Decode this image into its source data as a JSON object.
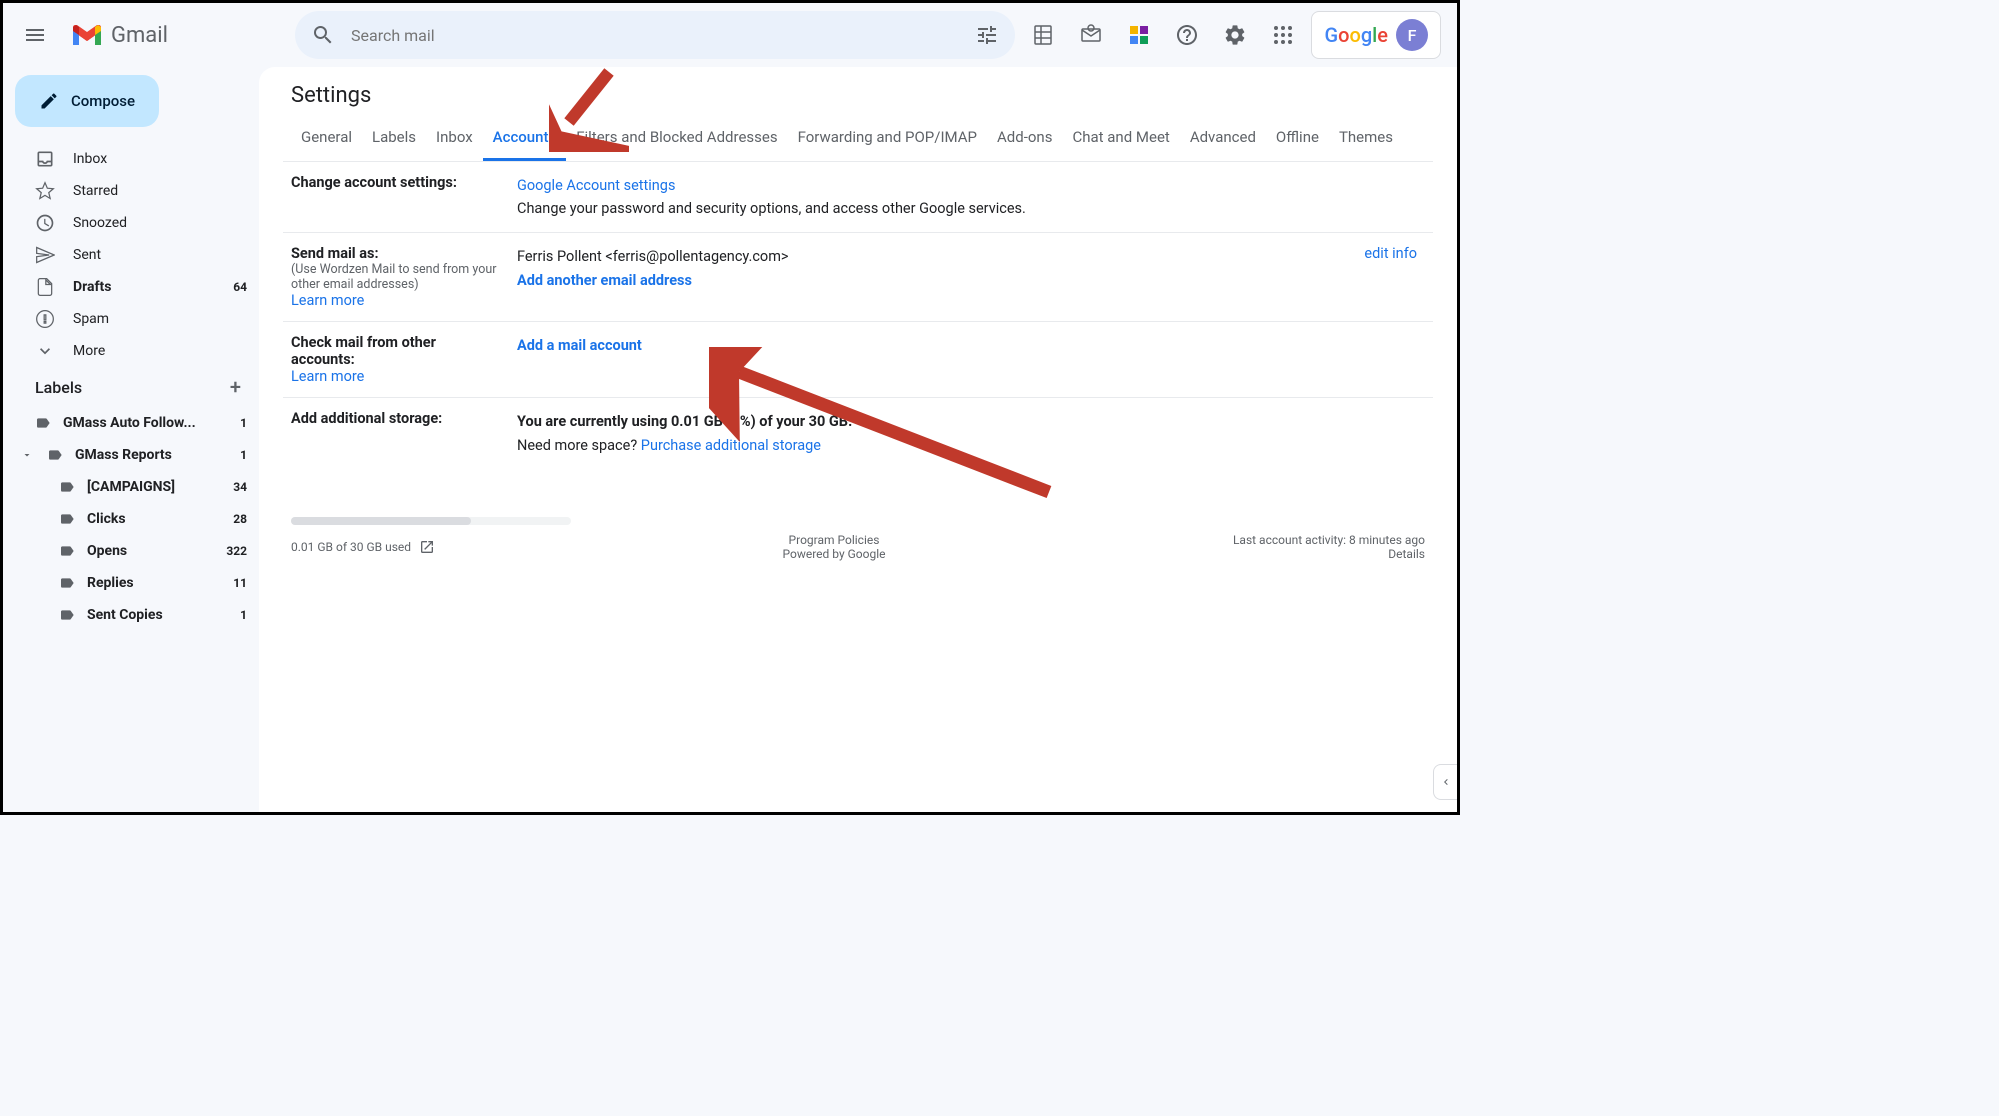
{
  "header": {
    "product": "Gmail",
    "search_placeholder": "Search mail",
    "avatar_initial": "F",
    "google_text": "Google"
  },
  "sidebar": {
    "compose": "Compose",
    "nav": [
      {
        "label": "Inbox",
        "count": "",
        "bold": false
      },
      {
        "label": "Starred",
        "count": "",
        "bold": false
      },
      {
        "label": "Snoozed",
        "count": "",
        "bold": false
      },
      {
        "label": "Sent",
        "count": "",
        "bold": false
      },
      {
        "label": "Drafts",
        "count": "64",
        "bold": true
      },
      {
        "label": "Spam",
        "count": "",
        "bold": false
      },
      {
        "label": "More",
        "count": "",
        "bold": false
      }
    ],
    "labels_header": "Labels",
    "labels": [
      {
        "label": "GMass Auto Follow...",
        "count": "1",
        "bold": true,
        "indent": 0,
        "caret": false
      },
      {
        "label": "GMass Reports",
        "count": "1",
        "bold": true,
        "indent": 0,
        "caret": true
      },
      {
        "label": "[CAMPAIGNS]",
        "count": "34",
        "bold": true,
        "indent": 1,
        "caret": false
      },
      {
        "label": "Clicks",
        "count": "28",
        "bold": true,
        "indent": 1,
        "caret": false
      },
      {
        "label": "Opens",
        "count": "322",
        "bold": true,
        "indent": 1,
        "caret": false
      },
      {
        "label": "Replies",
        "count": "11",
        "bold": true,
        "indent": 1,
        "caret": false
      },
      {
        "label": "Sent Copies",
        "count": "1",
        "bold": true,
        "indent": 1,
        "caret": false
      }
    ]
  },
  "main": {
    "title": "Settings",
    "tabs": [
      "General",
      "Labels",
      "Inbox",
      "Accounts",
      "Filters and Blocked Addresses",
      "Forwarding and POP/IMAP",
      "Add-ons",
      "Chat and Meet",
      "Advanced",
      "Offline",
      "Themes"
    ],
    "active_tab": "Accounts",
    "sections": {
      "change_account": {
        "title": "Change account settings:",
        "link": "Google Account settings",
        "desc": "Change your password and security options, and access other Google services."
      },
      "send_as": {
        "title": "Send mail as:",
        "sub": "(Use Wordzen Mail to send from your other email addresses)",
        "learn": "Learn more",
        "name_email": "Ferris Pollent <ferris@pollentagency.com>",
        "add_link": "Add another email address",
        "edit": "edit info"
      },
      "check_mail": {
        "title": "Check mail from other accounts:",
        "learn": "Learn more",
        "add_link": "Add a mail account"
      },
      "storage": {
        "title": "Add additional storage:",
        "usage": "You are currently using 0.01 GB (0%) of your 30 GB.",
        "need": "Need more space? ",
        "purchase": "Purchase additional storage"
      }
    },
    "footer": {
      "storage_text": "0.01 GB of 30 GB used",
      "policies": "Program Policies",
      "powered": "Powered by Google",
      "activity": "Last account activity: 8 minutes ago",
      "details": "Details"
    }
  }
}
